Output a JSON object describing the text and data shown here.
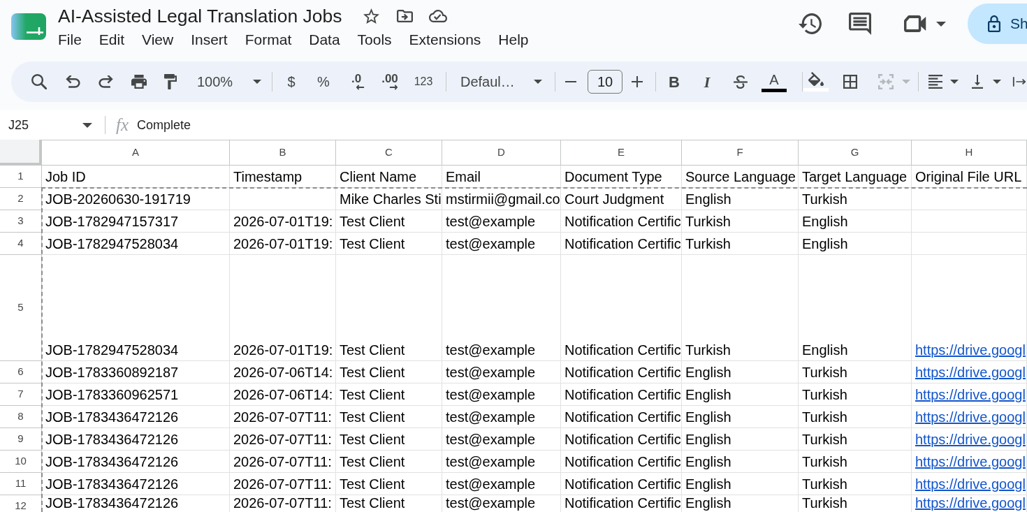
{
  "document": {
    "title": "AI-Assisted Legal Translation Jobs"
  },
  "menu": [
    "File",
    "Edit",
    "View",
    "Insert",
    "Format",
    "Data",
    "Tools",
    "Extensions",
    "Help"
  ],
  "share_button": {
    "label": "Sh"
  },
  "toolbar": {
    "zoom": "100%",
    "currency": "$",
    "percent": "%",
    "decrease_decimals": ".0",
    "increase_decimals": ".00",
    "number_format": "123",
    "font": "Defaul…",
    "font_size": "10",
    "bold": "B",
    "italic": "I",
    "text_color_label": "A",
    "merge_button": {
      "disabled": true
    }
  },
  "formula_bar": {
    "cell_reference": "J25",
    "function_label": "fx",
    "formula": "Complete"
  },
  "sheet": {
    "copy_marquee": true,
    "columns": [
      "A",
      "B",
      "C",
      "D",
      "E",
      "F",
      "G",
      "H"
    ],
    "rows": [
      {
        "number": "1",
        "kind": "normal",
        "cells": [
          "Job ID",
          "Timestamp",
          "Client Name",
          "Email",
          "Document Type",
          "Source Language",
          "Target Language",
          "Original File URL"
        ]
      },
      {
        "number": "2",
        "kind": "normal",
        "cells": [
          "JOB-20260630-191719",
          null,
          "Mike Charles Sti",
          "mstirmii@gmail.co",
          "Court Judgment",
          "English",
          "Turkish",
          null
        ]
      },
      {
        "number": "3",
        "kind": "normal",
        "cells": [
          "JOB-1782947157317",
          "2026-07-01T19:",
          "Test Client",
          "test@example",
          "Notification Certific",
          "Turkish",
          "English",
          null
        ]
      },
      {
        "number": "4",
        "kind": "normal",
        "cells": [
          "JOB-1782947528034",
          "2026-07-01T19:",
          "Test Client",
          "test@example",
          "Notification Certific",
          "Turkish",
          "English",
          null
        ]
      },
      {
        "number": "5",
        "kind": "tall",
        "cells": [
          "JOB-1782947528034",
          "2026-07-01T19:",
          "Test Client",
          "test@example",
          "Notification Certific",
          "Turkish",
          "English",
          {
            "kind": "link",
            "text": "https://drive.googl"
          }
        ]
      },
      {
        "number": "6",
        "kind": "normal",
        "cells": [
          "JOB-1783360892187",
          "2026-07-06T14:",
          "Test Client",
          "test@example",
          "Notification Certific",
          "English",
          "Turkish",
          {
            "kind": "link",
            "text": "https://drive.googl"
          }
        ]
      },
      {
        "number": "7",
        "kind": "normal",
        "cells": [
          "JOB-1783360962571",
          "2026-07-06T14:",
          "Test Client",
          "test@example",
          "Notification Certific",
          "English",
          "Turkish",
          {
            "kind": "link",
            "text": "https://drive.googl"
          }
        ]
      },
      {
        "number": "8",
        "kind": "normal",
        "cells": [
          "JOB-1783436472126",
          "2026-07-07T11:",
          "Test Client",
          "test@example",
          "Notification Certific",
          "English",
          "Turkish",
          {
            "kind": "link",
            "text": "https://drive.googl"
          }
        ]
      },
      {
        "number": "9",
        "kind": "normal",
        "cells": [
          "JOB-1783436472126",
          "2026-07-07T11:",
          "Test Client",
          "test@example",
          "Notification Certific",
          "English",
          "Turkish",
          {
            "kind": "link",
            "text": "https://drive.googl"
          }
        ]
      },
      {
        "number": "10",
        "kind": "normal",
        "cells": [
          "JOB-1783436472126",
          "2026-07-07T11:",
          "Test Client",
          "test@example",
          "Notification Certific",
          "English",
          "Turkish",
          {
            "kind": "link",
            "text": "https://drive.googl"
          }
        ]
      },
      {
        "number": "11",
        "kind": "normal",
        "cells": [
          "JOB-1783436472126",
          "2026-07-07T11:",
          "Test Client",
          "test@example",
          "Notification Certific",
          "English",
          "Turkish",
          {
            "kind": "link",
            "text": "https://drive.googl"
          }
        ]
      },
      {
        "number": "12",
        "kind": "normal",
        "cells": [
          "JOB-1783436472126",
          "2026-07-07T11:",
          "Test Client",
          "test@example",
          "Notification Certific",
          "English",
          "Turkish",
          {
            "kind": "link",
            "text": "https://drive.googl"
          }
        ]
      }
    ]
  }
}
